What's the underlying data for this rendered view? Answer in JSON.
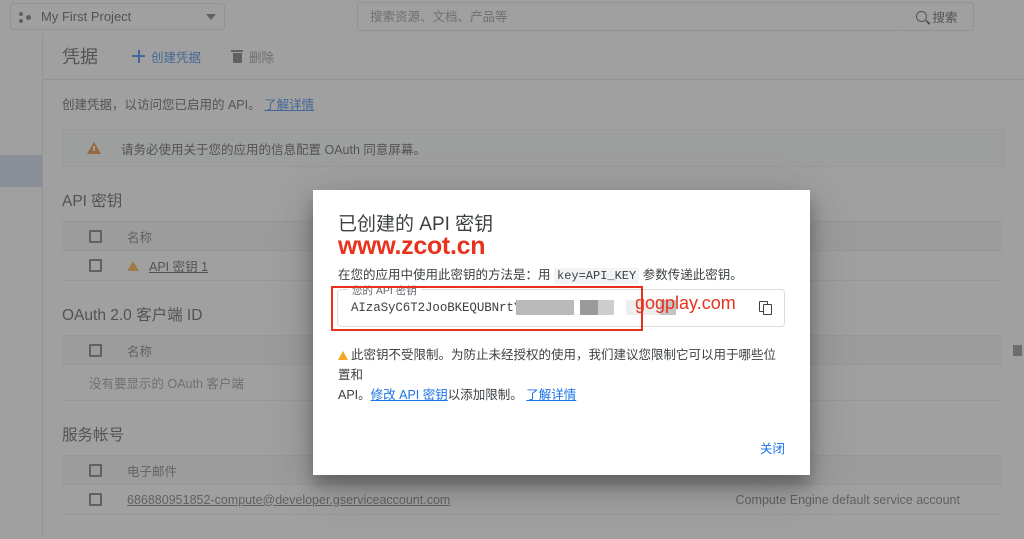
{
  "topbar": {
    "project_name": "My First Project",
    "project_icon": "project-dots-icon",
    "dropdown_icon": "chevron-down-icon",
    "search_placeholder": "搜索资源、文档、产品等",
    "search_value": "",
    "search_button_label": "搜索",
    "search_icon": "magnifier-icon"
  },
  "page": {
    "title": "凭据",
    "create_button_label": "创建凭据",
    "create_icon": "plus-icon",
    "delete_button_label": "删除",
    "delete_icon": "trash-icon",
    "description_text": "创建凭据，以访问您已启用的 API。",
    "description_link": "了解详情",
    "warning_banner": {
      "icon": "warning-triangle-icon",
      "text": "请务必使用关于您的应用的信息配置 OAuth 同意屏幕。"
    }
  },
  "sections": {
    "api_keys": {
      "title": "API 密钥",
      "column_header": "名称",
      "rows": [
        {
          "name": "API 密钥 1",
          "has_warning": true
        }
      ]
    },
    "oauth_clients": {
      "title": "OAuth 2.0 客户端 ID",
      "column_header": "名称",
      "empty_text": "没有要显示的 OAuth 客户端"
    },
    "service_accounts": {
      "title": "服务帐号",
      "column_header": "电子邮件",
      "rows": [
        {
          "email": "686880951852-compute@developer.gserviceaccount.com",
          "note": "Compute Engine default service account"
        }
      ]
    }
  },
  "modal": {
    "title": "已创建的 API 密钥",
    "watermark_top": "www.zcot.cn",
    "watermark_field": "gogplay.com",
    "desc_before": "在您的应用中使用此密钥的方法是：用",
    "desc_code": "key=API_KEY",
    "desc_after": "参数传递此密钥。",
    "key_field_label": "您的 API 密钥",
    "key_value_visible": "AIzaSyC6T2JooBKEQUBNrtY",
    "copy_icon": "copy-icon",
    "warning_icon": "warning-triangle-icon",
    "warning_line1": "此密钥不受限制。为防止未经授权的使用，我们建议您限制它可以用于哪些位置和",
    "warning_line2_prefix": "API。",
    "warning_link_edit": "修改 API 密钥",
    "warning_line2_mid": "以添加限制。",
    "warning_link_learn": "了解详情",
    "close_button_label": "关闭"
  },
  "colors": {
    "accent_blue": "#1a73e8",
    "watermark_red": "#e8321e",
    "warning_orange": "#f5a623",
    "banner_orange": "#e8710a",
    "rail_active": "#c8d1e8"
  }
}
